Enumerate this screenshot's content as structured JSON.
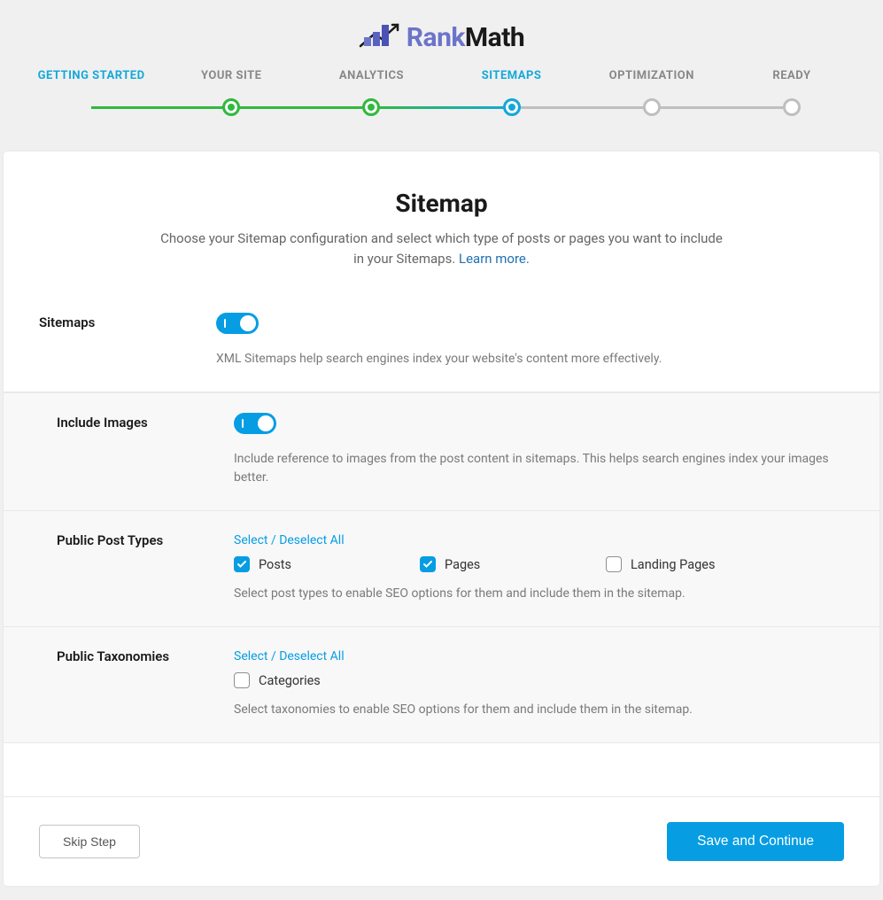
{
  "brand": {
    "rank": "Rank",
    "math": "Math"
  },
  "steps": [
    {
      "label": "GETTING STARTED"
    },
    {
      "label": "YOUR SITE"
    },
    {
      "label": "ANALYTICS"
    },
    {
      "label": "SITEMAPS"
    },
    {
      "label": "OPTIMIZATION"
    },
    {
      "label": "READY"
    }
  ],
  "page": {
    "title": "Sitemap",
    "desc_a": "Choose your Sitemap configuration and select which type of posts or pages you want to include in your Sitemaps. ",
    "learn_more": "Learn more."
  },
  "settings": {
    "sitemaps": {
      "label": "Sitemaps",
      "help": "XML Sitemaps help search engines index your website's content more effectively."
    },
    "images": {
      "label": "Include Images",
      "help": "Include reference to images from the post content in sitemaps. This helps search engines index your images better."
    },
    "post_types": {
      "label": "Public Post Types",
      "select_all": "Select / Deselect All",
      "items": [
        {
          "label": "Posts",
          "checked": true
        },
        {
          "label": "Pages",
          "checked": true
        },
        {
          "label": "Landing Pages",
          "checked": false
        }
      ],
      "help": "Select post types to enable SEO options for them and include them in the sitemap."
    },
    "taxonomies": {
      "label": "Public Taxonomies",
      "select_all": "Select / Deselect All",
      "items": [
        {
          "label": "Categories",
          "checked": false
        }
      ],
      "help": "Select taxonomies to enable SEO options for them and include them in the sitemap."
    }
  },
  "footer": {
    "skip": "Skip Step",
    "save": "Save and Continue"
  }
}
